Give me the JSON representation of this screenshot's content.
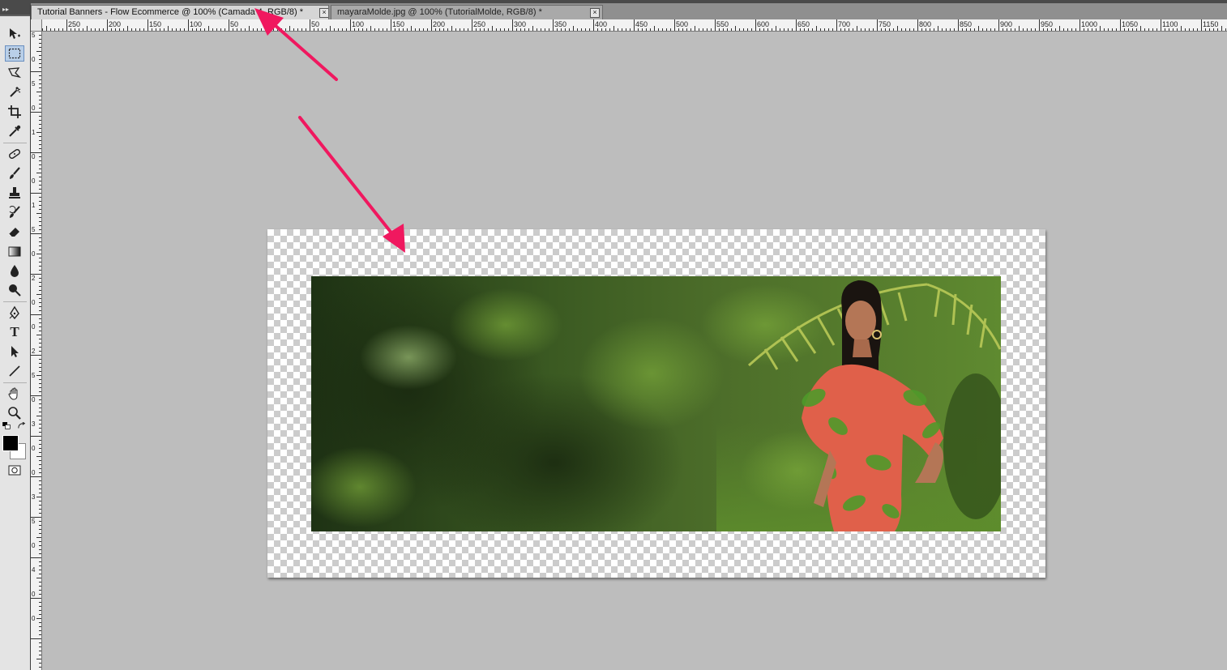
{
  "tabs": [
    {
      "label": "Tutorial Banners - Flow Ecommerce @ 100% (Camada 4, RGB/8) *",
      "close": "×",
      "active": true
    },
    {
      "label": "mayaraMolde.jpg @ 100% (TutorialMolde, RGB/8) *",
      "close": "×",
      "active": false
    }
  ],
  "ruler_h": {
    "labels": [
      "250",
      "200",
      "150",
      "100",
      "50",
      "0",
      "50",
      "100",
      "150",
      "200",
      "250",
      "300",
      "350",
      "400",
      "450",
      "500",
      "550",
      "600",
      "650",
      "700",
      "750",
      "800",
      "850",
      "900",
      "950",
      "1000",
      "1050",
      "1100",
      "1150"
    ]
  },
  "ruler_v": {
    "labels": [
      "5",
      "0",
      "5",
      "0",
      "1",
      "0",
      "0",
      "1",
      "5",
      "0",
      "2",
      "0",
      "0",
      "2",
      "5",
      "0",
      "3",
      "0",
      "0",
      "3",
      "5",
      "0",
      "4",
      "0",
      "0"
    ]
  },
  "toolbox": {
    "grip": "▸▸",
    "tools": [
      "move-tool-icon",
      "marquee-tool-icon",
      "lasso-tool-icon",
      "quick-selection-tool-icon",
      "crop-tool-icon",
      "eyedropper-tool-icon",
      "spot-healing-tool-icon",
      "brush-tool-icon",
      "clone-stamp-tool-icon",
      "history-brush-tool-icon",
      "eraser-tool-icon",
      "gradient-tool-icon",
      "blur-tool-icon",
      "dodge-tool-icon",
      "pen-tool-icon",
      "type-tool-icon",
      "path-selection-tool-icon",
      "line-tool-icon",
      "hand-tool-icon",
      "zoom-tool-icon"
    ],
    "selected_tool": "marquee-tool-icon",
    "type_glyph": "T"
  },
  "colors": {
    "foreground": "#000000",
    "background": "#ffffff",
    "arrow": "#f0185f",
    "workspace": "#bdbdbd"
  }
}
